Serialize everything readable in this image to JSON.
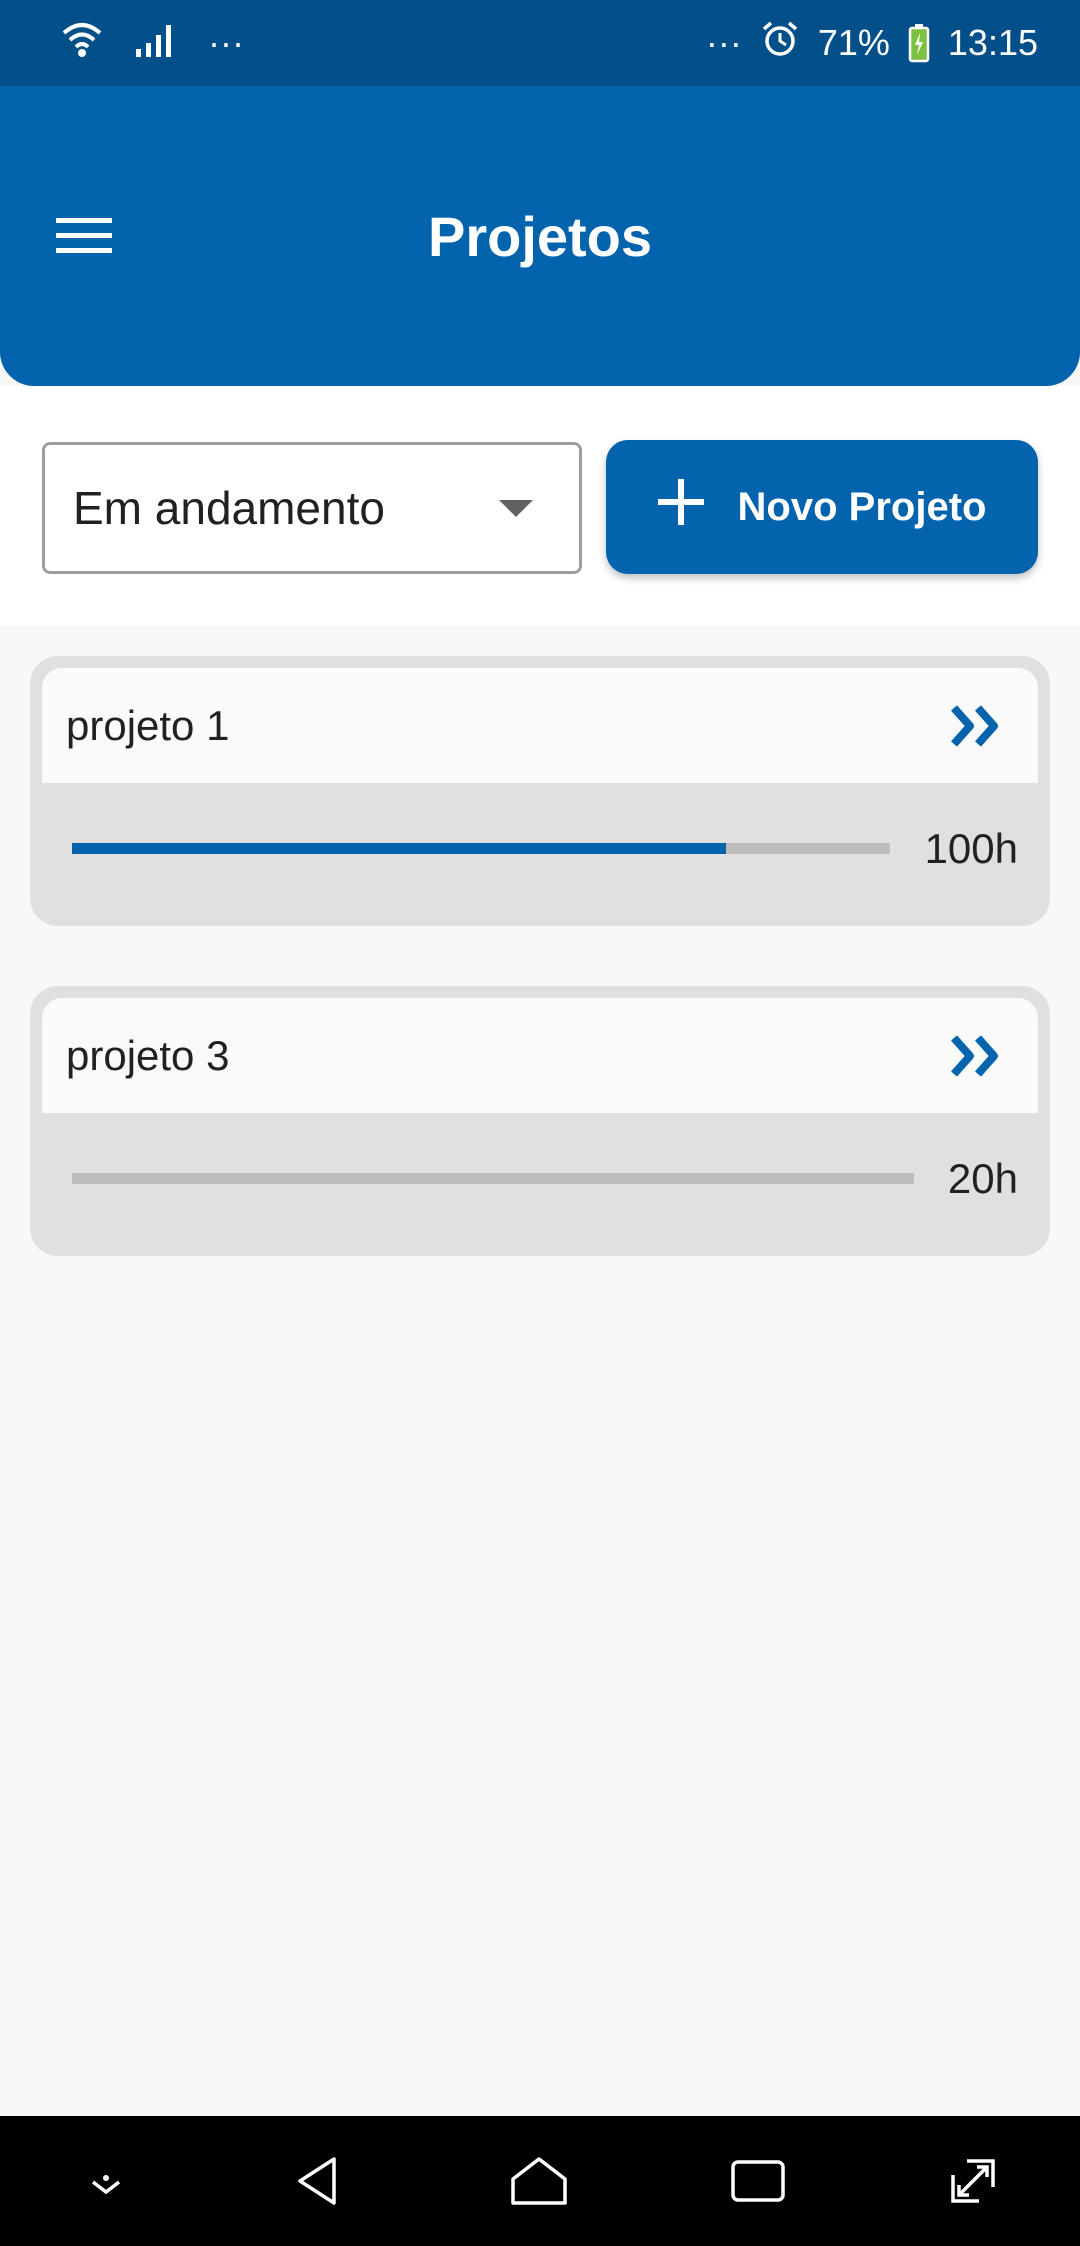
{
  "status_bar": {
    "dots_left": "···",
    "dots_right": "···",
    "battery": "71%",
    "time": "13:15"
  },
  "app_bar": {
    "title": "Projetos"
  },
  "filter": {
    "selected": "Em andamento"
  },
  "new_project_button": {
    "label": "Novo Projeto"
  },
  "projects": [
    {
      "name": "projeto 1",
      "hours": "100h",
      "progress": 0.8
    },
    {
      "name": "projeto 3",
      "hours": "20h",
      "progress": 0.0
    }
  ],
  "colors": {
    "primary": "#0363ad",
    "status_bar": "#024f8a",
    "card_bg": "#e0e0e0",
    "track": "#bdbdbd"
  },
  "icons": {
    "menu": "menu-icon",
    "add": "plus-icon",
    "open": "double-chevron-right-icon",
    "dropdown": "caret-down-icon"
  }
}
